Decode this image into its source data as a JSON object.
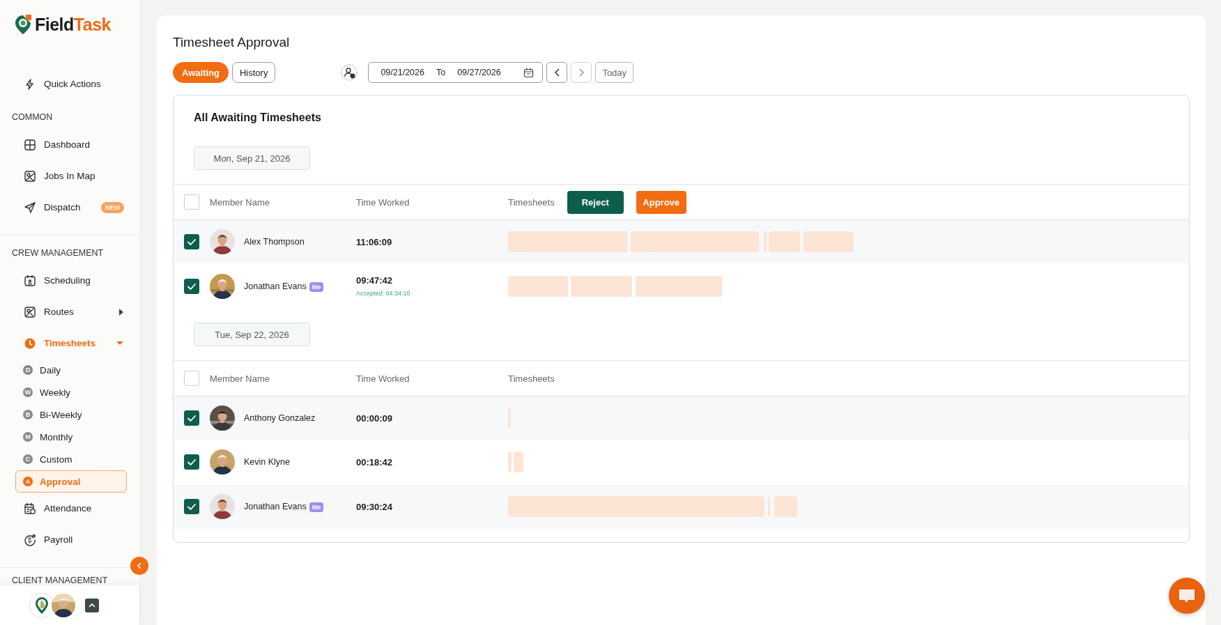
{
  "brand": {
    "first": "Field",
    "second": "Task"
  },
  "sidebar": {
    "quick_action": {
      "label": "Quick Actions"
    },
    "sections": [
      {
        "title": "COMMON",
        "items": [
          {
            "label": "Dashboard"
          },
          {
            "label": "Jobs In Map"
          },
          {
            "label": "Dispatch",
            "badge": "NEW"
          }
        ]
      },
      {
        "title": "CREW MANAGEMENT",
        "items": [
          {
            "label": "Scheduling"
          },
          {
            "label": "Routes",
            "expanded": false
          },
          {
            "label": "Timesheets",
            "expanded": true,
            "children": [
              {
                "letter": "D",
                "label": "Daily",
                "selected": false
              },
              {
                "letter": "W",
                "label": "Weekly",
                "selected": false
              },
              {
                "letter": "B",
                "label": "Bi-Weekly",
                "selected": false
              },
              {
                "letter": "M",
                "label": "Monthly",
                "selected": false
              },
              {
                "letter": "C",
                "label": "Custom",
                "selected": false
              },
              {
                "letter": "A",
                "label": "Approval",
                "selected": true
              }
            ]
          },
          {
            "label": "Attendance"
          },
          {
            "label": "Payroll"
          }
        ]
      },
      {
        "title": "CLIENT MANAGEMENT"
      }
    ]
  },
  "page": {
    "title": "Timesheet Approval",
    "tabs": [
      {
        "label": "Awaiting",
        "selected": true
      },
      {
        "label": "History",
        "selected": false
      }
    ],
    "date_range": {
      "from": "09/21/2026",
      "separator": "To",
      "to": "09/27/2026"
    },
    "today_button": "Today",
    "card": {
      "title": "All Awaiting Timesheets",
      "groups": [
        {
          "date": "Mon, Sep 21, 2026",
          "all_checked": false,
          "columns": [
            "Member Name",
            "Time Worked",
            "Timesheets"
          ],
          "actions": [
            {
              "kind": "reject",
              "label": "Reject"
            },
            {
              "kind": "approve",
              "label": "Approve"
            }
          ],
          "rows": [
            {
              "name": "Alex Thompson",
              "time": "11:06:09",
              "checked": true
            },
            {
              "name": "Jonathan Evans",
              "badge": "Me",
              "time": "09:47:42",
              "note": "Accepted: 04:34:10",
              "checked": true
            }
          ]
        },
        {
          "date": "Tue, Sep 22, 2026",
          "all_checked": false,
          "columns": [
            "Member Name",
            "Time Worked",
            "Timesheets"
          ],
          "rows": [
            {
              "name": "Anthony Gonzalez",
              "time": "00:00:09",
              "checked": true
            },
            {
              "name": "Kevin Klyne",
              "time": "00:18:42",
              "checked": true
            },
            {
              "name": "Jonathan Evans",
              "badge": "Me",
              "time": "09:30:24",
              "checked": true
            }
          ]
        }
      ]
    }
  }
}
